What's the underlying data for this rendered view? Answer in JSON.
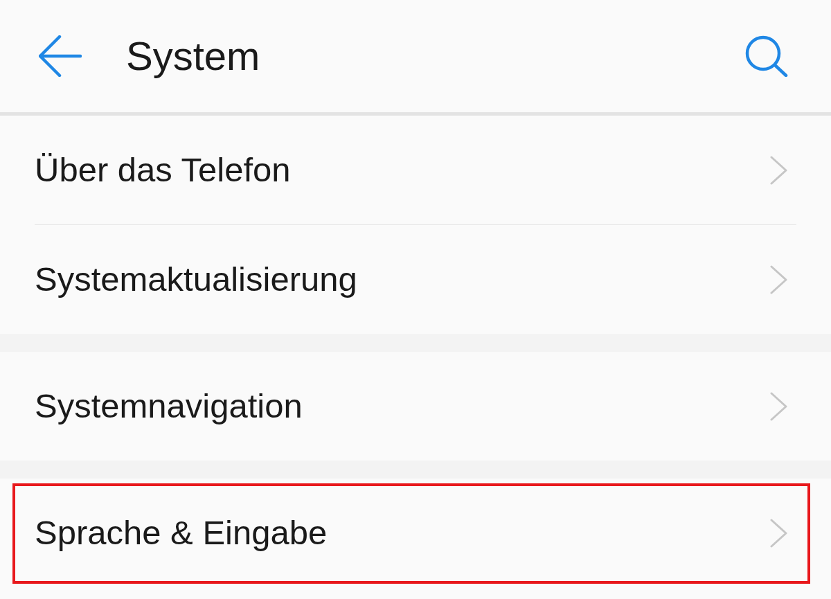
{
  "header": {
    "title": "System"
  },
  "groups": [
    {
      "items": [
        {
          "label": "Über das Telefon",
          "highlighted": false
        },
        {
          "label": "Systemaktualisierung",
          "highlighted": false
        }
      ]
    },
    {
      "items": [
        {
          "label": "Systemnavigation",
          "highlighted": false
        }
      ]
    },
    {
      "items": [
        {
          "label": "Sprache & Eingabe",
          "highlighted": true
        }
      ]
    }
  ]
}
